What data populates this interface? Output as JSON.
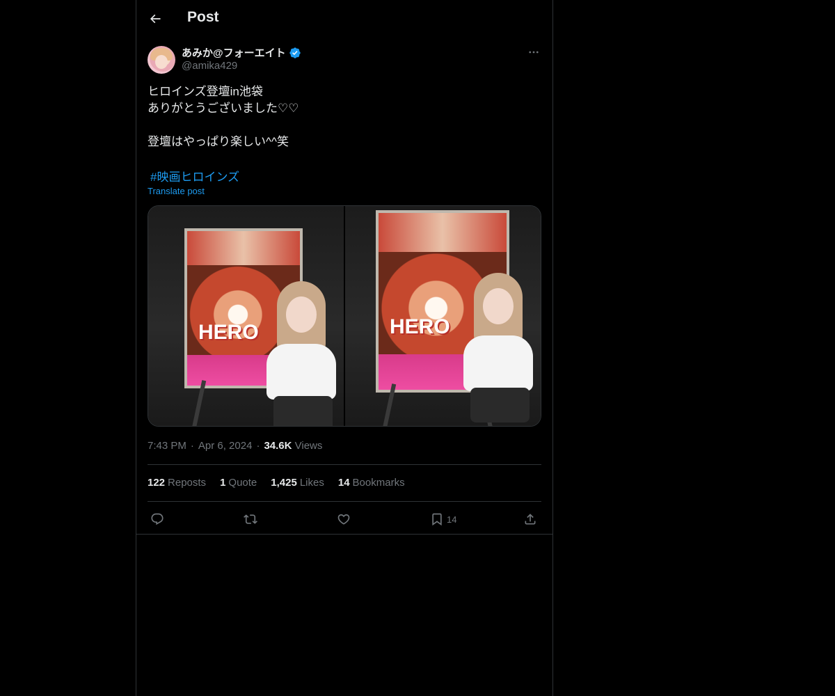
{
  "topbar": {
    "title": "Post",
    "back_icon": "arrow-left-icon"
  },
  "author": {
    "display_name": "あみか@フォーエイト",
    "handle": "@amika429",
    "verified": true,
    "verified_color": "#1d9bf0"
  },
  "post": {
    "text": "ヒロインズ登壇in池袋\nありがとうございました♡♡\n\n登壇はやっぱり楽しい^^笑",
    "hashtag": "#映画ヒロインズ",
    "translate_label": "Translate post",
    "media": {
      "poster_title": "HERO"
    }
  },
  "meta": {
    "time": "7:43 PM",
    "separator": "·",
    "date": "Apr 6, 2024",
    "views_count": "34.6K",
    "views_label": "Views"
  },
  "counts": {
    "reposts_count": "122",
    "reposts_label": "Reposts",
    "quotes_count": "1",
    "quotes_label": "Quote",
    "likes_count": "1,425",
    "likes_label": "Likes",
    "bookmarks_count": "14",
    "bookmarks_label": "Bookmarks"
  },
  "actions": {
    "bookmark_count": "14"
  },
  "colors": {
    "background": "#000000",
    "text": "#e7e9ea",
    "muted": "#71767b",
    "accent": "#1d9bf0",
    "border": "#2f3336"
  }
}
